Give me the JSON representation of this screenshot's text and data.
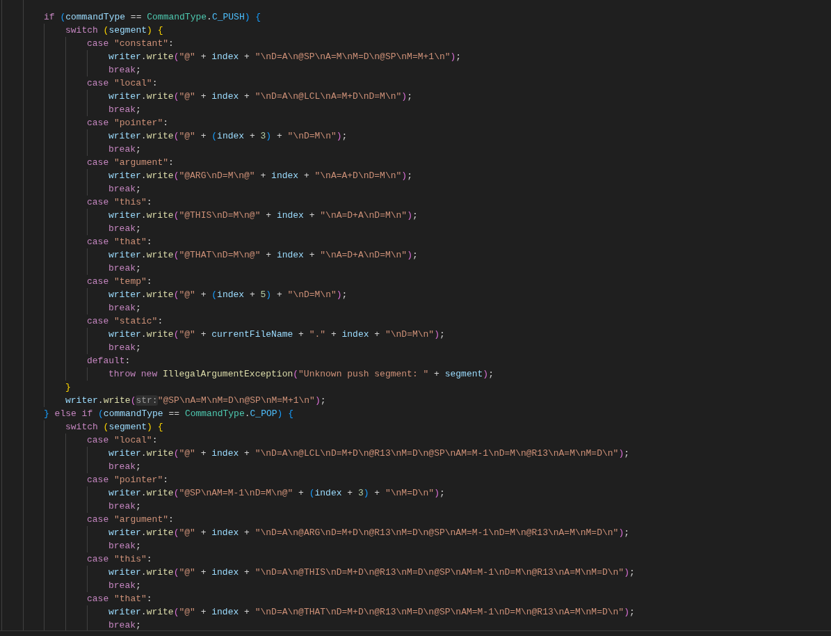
{
  "editor": {
    "lines": [
      {
        "tokens": [
          {
            "kind": "keyword",
            "text": "if "
          },
          {
            "kind": "bracket3",
            "text": "("
          },
          {
            "kind": "variable",
            "text": "commandType"
          },
          {
            "kind": "plain",
            "text": " == "
          },
          {
            "kind": "type",
            "text": "CommandType"
          },
          {
            "kind": "plain",
            "text": "."
          },
          {
            "kind": "constant",
            "text": "C_PUSH"
          },
          {
            "kind": "bracket3",
            "text": ") "
          },
          {
            "kind": "bracket3",
            "text": "{"
          }
        ],
        "children": [
          {
            "tokens": [
              {
                "kind": "keyword",
                "text": "switch "
              },
              {
                "kind": "bracket1",
                "text": "("
              },
              {
                "kind": "variable",
                "text": "segment"
              },
              {
                "kind": "bracket1",
                "text": ") "
              },
              {
                "kind": "bracket1",
                "text": "{"
              }
            ],
            "children": [
              {
                "tokens": [
                  {
                    "kind": "keyword",
                    "text": "case "
                  },
                  {
                    "kind": "string",
                    "text": "\"constant\""
                  },
                  {
                    "kind": "plain",
                    "text": ":"
                  }
                ],
                "children": [
                  {
                    "tokens": [
                      {
                        "kind": "variable",
                        "text": "writer"
                      },
                      {
                        "kind": "plain",
                        "text": "."
                      },
                      {
                        "kind": "function",
                        "text": "write"
                      },
                      {
                        "kind": "bracket2",
                        "text": "("
                      },
                      {
                        "kind": "string",
                        "text": "\"@\""
                      },
                      {
                        "kind": "plain",
                        "text": " + "
                      },
                      {
                        "kind": "variable",
                        "text": "index"
                      },
                      {
                        "kind": "plain",
                        "text": " + "
                      },
                      {
                        "kind": "string",
                        "text": "\"\\nD=A\\n@SP\\nA=M\\nM=D\\n@SP\\nM=M+1\\n\""
                      },
                      {
                        "kind": "bracket2",
                        "text": ")"
                      },
                      {
                        "kind": "plain",
                        "text": ";"
                      }
                    ]
                  },
                  {
                    "tokens": [
                      {
                        "kind": "keyword",
                        "text": "break"
                      },
                      {
                        "kind": "plain",
                        "text": ";"
                      }
                    ]
                  }
                ]
              },
              {
                "tokens": [
                  {
                    "kind": "keyword",
                    "text": "case "
                  },
                  {
                    "kind": "string",
                    "text": "\"local\""
                  },
                  {
                    "kind": "plain",
                    "text": ":"
                  }
                ],
                "children": [
                  {
                    "tokens": [
                      {
                        "kind": "variable",
                        "text": "writer"
                      },
                      {
                        "kind": "plain",
                        "text": "."
                      },
                      {
                        "kind": "function",
                        "text": "write"
                      },
                      {
                        "kind": "bracket2",
                        "text": "("
                      },
                      {
                        "kind": "string",
                        "text": "\"@\""
                      },
                      {
                        "kind": "plain",
                        "text": " + "
                      },
                      {
                        "kind": "variable",
                        "text": "index"
                      },
                      {
                        "kind": "plain",
                        "text": " + "
                      },
                      {
                        "kind": "string",
                        "text": "\"\\nD=A\\n@LCL\\nA=M+D\\nD=M\\n\""
                      },
                      {
                        "kind": "bracket2",
                        "text": ")"
                      },
                      {
                        "kind": "plain",
                        "text": ";"
                      }
                    ]
                  },
                  {
                    "tokens": [
                      {
                        "kind": "keyword",
                        "text": "break"
                      },
                      {
                        "kind": "plain",
                        "text": ";"
                      }
                    ]
                  }
                ]
              },
              {
                "tokens": [
                  {
                    "kind": "keyword",
                    "text": "case "
                  },
                  {
                    "kind": "string",
                    "text": "\"pointer\""
                  },
                  {
                    "kind": "plain",
                    "text": ":"
                  }
                ],
                "children": [
                  {
                    "tokens": [
                      {
                        "kind": "variable",
                        "text": "writer"
                      },
                      {
                        "kind": "plain",
                        "text": "."
                      },
                      {
                        "kind": "function",
                        "text": "write"
                      },
                      {
                        "kind": "bracket2",
                        "text": "("
                      },
                      {
                        "kind": "string",
                        "text": "\"@\""
                      },
                      {
                        "kind": "plain",
                        "text": " + "
                      },
                      {
                        "kind": "bracket3",
                        "text": "("
                      },
                      {
                        "kind": "variable",
                        "text": "index"
                      },
                      {
                        "kind": "plain",
                        "text": " + "
                      },
                      {
                        "kind": "number",
                        "text": "3"
                      },
                      {
                        "kind": "bracket3",
                        "text": ")"
                      },
                      {
                        "kind": "plain",
                        "text": " + "
                      },
                      {
                        "kind": "string",
                        "text": "\"\\nD=M\\n\""
                      },
                      {
                        "kind": "bracket2",
                        "text": ")"
                      },
                      {
                        "kind": "plain",
                        "text": ";"
                      }
                    ]
                  },
                  {
                    "tokens": [
                      {
                        "kind": "keyword",
                        "text": "break"
                      },
                      {
                        "kind": "plain",
                        "text": ";"
                      }
                    ]
                  }
                ]
              },
              {
                "tokens": [
                  {
                    "kind": "keyword",
                    "text": "case "
                  },
                  {
                    "kind": "string",
                    "text": "\"argument\""
                  },
                  {
                    "kind": "plain",
                    "text": ":"
                  }
                ],
                "children": [
                  {
                    "tokens": [
                      {
                        "kind": "variable",
                        "text": "writer"
                      },
                      {
                        "kind": "plain",
                        "text": "."
                      },
                      {
                        "kind": "function",
                        "text": "write"
                      },
                      {
                        "kind": "bracket2",
                        "text": "("
                      },
                      {
                        "kind": "string",
                        "text": "\"@ARG\\nD=M\\n@\""
                      },
                      {
                        "kind": "plain",
                        "text": " + "
                      },
                      {
                        "kind": "variable",
                        "text": "index"
                      },
                      {
                        "kind": "plain",
                        "text": " + "
                      },
                      {
                        "kind": "string",
                        "text": "\"\\nA=A+D\\nD=M\\n\""
                      },
                      {
                        "kind": "bracket2",
                        "text": ")"
                      },
                      {
                        "kind": "plain",
                        "text": ";"
                      }
                    ]
                  },
                  {
                    "tokens": [
                      {
                        "kind": "keyword",
                        "text": "break"
                      },
                      {
                        "kind": "plain",
                        "text": ";"
                      }
                    ]
                  }
                ]
              },
              {
                "tokens": [
                  {
                    "kind": "keyword",
                    "text": "case "
                  },
                  {
                    "kind": "string",
                    "text": "\"this\""
                  },
                  {
                    "kind": "plain",
                    "text": ":"
                  }
                ],
                "children": [
                  {
                    "tokens": [
                      {
                        "kind": "variable",
                        "text": "writer"
                      },
                      {
                        "kind": "plain",
                        "text": "."
                      },
                      {
                        "kind": "function",
                        "text": "write"
                      },
                      {
                        "kind": "bracket2",
                        "text": "("
                      },
                      {
                        "kind": "string",
                        "text": "\"@THIS\\nD=M\\n@\""
                      },
                      {
                        "kind": "plain",
                        "text": " + "
                      },
                      {
                        "kind": "variable",
                        "text": "index"
                      },
                      {
                        "kind": "plain",
                        "text": " + "
                      },
                      {
                        "kind": "string",
                        "text": "\"\\nA=D+A\\nD=M\\n\""
                      },
                      {
                        "kind": "bracket2",
                        "text": ")"
                      },
                      {
                        "kind": "plain",
                        "text": ";"
                      }
                    ]
                  },
                  {
                    "tokens": [
                      {
                        "kind": "keyword",
                        "text": "break"
                      },
                      {
                        "kind": "plain",
                        "text": ";"
                      }
                    ]
                  }
                ]
              },
              {
                "tokens": [
                  {
                    "kind": "keyword",
                    "text": "case "
                  },
                  {
                    "kind": "string",
                    "text": "\"that\""
                  },
                  {
                    "kind": "plain",
                    "text": ":"
                  }
                ],
                "children": [
                  {
                    "tokens": [
                      {
                        "kind": "variable",
                        "text": "writer"
                      },
                      {
                        "kind": "plain",
                        "text": "."
                      },
                      {
                        "kind": "function",
                        "text": "write"
                      },
                      {
                        "kind": "bracket2",
                        "text": "("
                      },
                      {
                        "kind": "string",
                        "text": "\"@THAT\\nD=M\\n@\""
                      },
                      {
                        "kind": "plain",
                        "text": " + "
                      },
                      {
                        "kind": "variable",
                        "text": "index"
                      },
                      {
                        "kind": "plain",
                        "text": " + "
                      },
                      {
                        "kind": "string",
                        "text": "\"\\nA=D+A\\nD=M\\n\""
                      },
                      {
                        "kind": "bracket2",
                        "text": ")"
                      },
                      {
                        "kind": "plain",
                        "text": ";"
                      }
                    ]
                  },
                  {
                    "tokens": [
                      {
                        "kind": "keyword",
                        "text": "break"
                      },
                      {
                        "kind": "plain",
                        "text": ";"
                      }
                    ]
                  }
                ]
              },
              {
                "tokens": [
                  {
                    "kind": "keyword",
                    "text": "case "
                  },
                  {
                    "kind": "string",
                    "text": "\"temp\""
                  },
                  {
                    "kind": "plain",
                    "text": ":"
                  }
                ],
                "children": [
                  {
                    "tokens": [
                      {
                        "kind": "variable",
                        "text": "writer"
                      },
                      {
                        "kind": "plain",
                        "text": "."
                      },
                      {
                        "kind": "function",
                        "text": "write"
                      },
                      {
                        "kind": "bracket2",
                        "text": "("
                      },
                      {
                        "kind": "string",
                        "text": "\"@\""
                      },
                      {
                        "kind": "plain",
                        "text": " + "
                      },
                      {
                        "kind": "bracket3",
                        "text": "("
                      },
                      {
                        "kind": "variable",
                        "text": "index"
                      },
                      {
                        "kind": "plain",
                        "text": " + "
                      },
                      {
                        "kind": "number",
                        "text": "5"
                      },
                      {
                        "kind": "bracket3",
                        "text": ")"
                      },
                      {
                        "kind": "plain",
                        "text": " + "
                      },
                      {
                        "kind": "string",
                        "text": "\"\\nD=M\\n\""
                      },
                      {
                        "kind": "bracket2",
                        "text": ")"
                      },
                      {
                        "kind": "plain",
                        "text": ";"
                      }
                    ]
                  },
                  {
                    "tokens": [
                      {
                        "kind": "keyword",
                        "text": "break"
                      },
                      {
                        "kind": "plain",
                        "text": ";"
                      }
                    ]
                  }
                ]
              },
              {
                "tokens": [
                  {
                    "kind": "keyword",
                    "text": "case "
                  },
                  {
                    "kind": "string",
                    "text": "\"static\""
                  },
                  {
                    "kind": "plain",
                    "text": ":"
                  }
                ],
                "children": [
                  {
                    "tokens": [
                      {
                        "kind": "variable",
                        "text": "writer"
                      },
                      {
                        "kind": "plain",
                        "text": "."
                      },
                      {
                        "kind": "function",
                        "text": "write"
                      },
                      {
                        "kind": "bracket2",
                        "text": "("
                      },
                      {
                        "kind": "string",
                        "text": "\"@\""
                      },
                      {
                        "kind": "plain",
                        "text": " + "
                      },
                      {
                        "kind": "variable",
                        "text": "currentFileName"
                      },
                      {
                        "kind": "plain",
                        "text": " + "
                      },
                      {
                        "kind": "string",
                        "text": "\".\""
                      },
                      {
                        "kind": "plain",
                        "text": " + "
                      },
                      {
                        "kind": "variable",
                        "text": "index"
                      },
                      {
                        "kind": "plain",
                        "text": " + "
                      },
                      {
                        "kind": "string",
                        "text": "\"\\nD=M\\n\""
                      },
                      {
                        "kind": "bracket2",
                        "text": ")"
                      },
                      {
                        "kind": "plain",
                        "text": ";"
                      }
                    ]
                  },
                  {
                    "tokens": [
                      {
                        "kind": "keyword",
                        "text": "break"
                      },
                      {
                        "kind": "plain",
                        "text": ";"
                      }
                    ]
                  }
                ]
              },
              {
                "tokens": [
                  {
                    "kind": "keyword",
                    "text": "default"
                  },
                  {
                    "kind": "plain",
                    "text": ":"
                  }
                ],
                "children": [
                  {
                    "tokens": [
                      {
                        "kind": "keyword",
                        "text": "throw new "
                      },
                      {
                        "kind": "function",
                        "text": "IllegalArgumentException"
                      },
                      {
                        "kind": "bracket2",
                        "text": "("
                      },
                      {
                        "kind": "string",
                        "text": "\"Unknown push segment: \""
                      },
                      {
                        "kind": "plain",
                        "text": " + "
                      },
                      {
                        "kind": "variable",
                        "text": "segment"
                      },
                      {
                        "kind": "bracket2",
                        "text": ")"
                      },
                      {
                        "kind": "plain",
                        "text": ";"
                      }
                    ]
                  }
                ]
              }
            ]
          },
          {
            "tokens": [
              {
                "kind": "bracket1",
                "text": "}"
              }
            ]
          },
          {
            "tokens": [
              {
                "kind": "variable",
                "text": "writer"
              },
              {
                "kind": "plain",
                "text": "."
              },
              {
                "kind": "function",
                "text": "write"
              },
              {
                "kind": "bracket2",
                "text": "("
              },
              {
                "kind": "hint",
                "text": "str:"
              },
              {
                "kind": "string",
                "text": "\"@SP\\nA=M\\nM=D\\n@SP\\nM=M+1\\n\""
              },
              {
                "kind": "bracket2",
                "text": ")"
              },
              {
                "kind": "plain",
                "text": ";"
              }
            ]
          }
        ]
      },
      {
        "tokens": [
          {
            "kind": "bracket3",
            "text": "} "
          },
          {
            "kind": "keyword",
            "text": "else if "
          },
          {
            "kind": "bracket3",
            "text": "("
          },
          {
            "kind": "variable",
            "text": "commandType"
          },
          {
            "kind": "plain",
            "text": " == "
          },
          {
            "kind": "type",
            "text": "CommandType"
          },
          {
            "kind": "plain",
            "text": "."
          },
          {
            "kind": "constant",
            "text": "C_POP"
          },
          {
            "kind": "bracket3",
            "text": ") "
          },
          {
            "kind": "bracket3",
            "text": "{"
          }
        ],
        "children": [
          {
            "tokens": [
              {
                "kind": "keyword",
                "text": "switch "
              },
              {
                "kind": "bracket1",
                "text": "("
              },
              {
                "kind": "variable",
                "text": "segment"
              },
              {
                "kind": "bracket1",
                "text": ") "
              },
              {
                "kind": "bracket1",
                "text": "{"
              }
            ],
            "children": [
              {
                "tokens": [
                  {
                    "kind": "keyword",
                    "text": "case "
                  },
                  {
                    "kind": "string",
                    "text": "\"local\""
                  },
                  {
                    "kind": "plain",
                    "text": ":"
                  }
                ],
                "children": [
                  {
                    "tokens": [
                      {
                        "kind": "variable",
                        "text": "writer"
                      },
                      {
                        "kind": "plain",
                        "text": "."
                      },
                      {
                        "kind": "function",
                        "text": "write"
                      },
                      {
                        "kind": "bracket2",
                        "text": "("
                      },
                      {
                        "kind": "string",
                        "text": "\"@\""
                      },
                      {
                        "kind": "plain",
                        "text": " + "
                      },
                      {
                        "kind": "variable",
                        "text": "index"
                      },
                      {
                        "kind": "plain",
                        "text": " + "
                      },
                      {
                        "kind": "string",
                        "text": "\"\\nD=A\\n@LCL\\nD=M+D\\n@R13\\nM=D\\n@SP\\nAM=M-1\\nD=M\\n@R13\\nA=M\\nM=D\\n\""
                      },
                      {
                        "kind": "bracket2",
                        "text": ")"
                      },
                      {
                        "kind": "plain",
                        "text": ";"
                      }
                    ]
                  },
                  {
                    "tokens": [
                      {
                        "kind": "keyword",
                        "text": "break"
                      },
                      {
                        "kind": "plain",
                        "text": ";"
                      }
                    ]
                  }
                ]
              },
              {
                "tokens": [
                  {
                    "kind": "keyword",
                    "text": "case "
                  },
                  {
                    "kind": "string",
                    "text": "\"pointer\""
                  },
                  {
                    "kind": "plain",
                    "text": ":"
                  }
                ],
                "children": [
                  {
                    "tokens": [
                      {
                        "kind": "variable",
                        "text": "writer"
                      },
                      {
                        "kind": "plain",
                        "text": "."
                      },
                      {
                        "kind": "function",
                        "text": "write"
                      },
                      {
                        "kind": "bracket2",
                        "text": "("
                      },
                      {
                        "kind": "string",
                        "text": "\"@SP\\nAM=M-1\\nD=M\\n@\""
                      },
                      {
                        "kind": "plain",
                        "text": " + "
                      },
                      {
                        "kind": "bracket3",
                        "text": "("
                      },
                      {
                        "kind": "variable",
                        "text": "index"
                      },
                      {
                        "kind": "plain",
                        "text": " + "
                      },
                      {
                        "kind": "number",
                        "text": "3"
                      },
                      {
                        "kind": "bracket3",
                        "text": ")"
                      },
                      {
                        "kind": "plain",
                        "text": " + "
                      },
                      {
                        "kind": "string",
                        "text": "\"\\nM=D\\n\""
                      },
                      {
                        "kind": "bracket2",
                        "text": ")"
                      },
                      {
                        "kind": "plain",
                        "text": ";"
                      }
                    ]
                  },
                  {
                    "tokens": [
                      {
                        "kind": "keyword",
                        "text": "break"
                      },
                      {
                        "kind": "plain",
                        "text": ";"
                      }
                    ]
                  }
                ]
              },
              {
                "tokens": [
                  {
                    "kind": "keyword",
                    "text": "case "
                  },
                  {
                    "kind": "string",
                    "text": "\"argument\""
                  },
                  {
                    "kind": "plain",
                    "text": ":"
                  }
                ],
                "children": [
                  {
                    "tokens": [
                      {
                        "kind": "variable",
                        "text": "writer"
                      },
                      {
                        "kind": "plain",
                        "text": "."
                      },
                      {
                        "kind": "function",
                        "text": "write"
                      },
                      {
                        "kind": "bracket2",
                        "text": "("
                      },
                      {
                        "kind": "string",
                        "text": "\"@\""
                      },
                      {
                        "kind": "plain",
                        "text": " + "
                      },
                      {
                        "kind": "variable",
                        "text": "index"
                      },
                      {
                        "kind": "plain",
                        "text": " + "
                      },
                      {
                        "kind": "string",
                        "text": "\"\\nD=A\\n@ARG\\nD=M+D\\n@R13\\nM=D\\n@SP\\nAM=M-1\\nD=M\\n@R13\\nA=M\\nM=D\\n\""
                      },
                      {
                        "kind": "bracket2",
                        "text": ")"
                      },
                      {
                        "kind": "plain",
                        "text": ";"
                      }
                    ]
                  },
                  {
                    "tokens": [
                      {
                        "kind": "keyword",
                        "text": "break"
                      },
                      {
                        "kind": "plain",
                        "text": ";"
                      }
                    ]
                  }
                ]
              },
              {
                "tokens": [
                  {
                    "kind": "keyword",
                    "text": "case "
                  },
                  {
                    "kind": "string",
                    "text": "\"this\""
                  },
                  {
                    "kind": "plain",
                    "text": ":"
                  }
                ],
                "children": [
                  {
                    "tokens": [
                      {
                        "kind": "variable",
                        "text": "writer"
                      },
                      {
                        "kind": "plain",
                        "text": "."
                      },
                      {
                        "kind": "function",
                        "text": "write"
                      },
                      {
                        "kind": "bracket2",
                        "text": "("
                      },
                      {
                        "kind": "string",
                        "text": "\"@\""
                      },
                      {
                        "kind": "plain",
                        "text": " + "
                      },
                      {
                        "kind": "variable",
                        "text": "index"
                      },
                      {
                        "kind": "plain",
                        "text": " + "
                      },
                      {
                        "kind": "string",
                        "text": "\"\\nD=A\\n@THIS\\nD=M+D\\n@R13\\nM=D\\n@SP\\nAM=M-1\\nD=M\\n@R13\\nA=M\\nM=D\\n\""
                      },
                      {
                        "kind": "bracket2",
                        "text": ")"
                      },
                      {
                        "kind": "plain",
                        "text": ";"
                      }
                    ]
                  },
                  {
                    "tokens": [
                      {
                        "kind": "keyword",
                        "text": "break"
                      },
                      {
                        "kind": "plain",
                        "text": ";"
                      }
                    ]
                  }
                ]
              },
              {
                "tokens": [
                  {
                    "kind": "keyword",
                    "text": "case "
                  },
                  {
                    "kind": "string",
                    "text": "\"that\""
                  },
                  {
                    "kind": "plain",
                    "text": ":"
                  }
                ],
                "children": [
                  {
                    "tokens": [
                      {
                        "kind": "variable",
                        "text": "writer"
                      },
                      {
                        "kind": "plain",
                        "text": "."
                      },
                      {
                        "kind": "function",
                        "text": "write"
                      },
                      {
                        "kind": "bracket2",
                        "text": "("
                      },
                      {
                        "kind": "string",
                        "text": "\"@\""
                      },
                      {
                        "kind": "plain",
                        "text": " + "
                      },
                      {
                        "kind": "variable",
                        "text": "index"
                      },
                      {
                        "kind": "plain",
                        "text": " + "
                      },
                      {
                        "kind": "string",
                        "text": "\"\\nD=A\\n@THAT\\nD=M+D\\n@R13\\nM=D\\n@SP\\nAM=M-1\\nD=M\\n@R13\\nA=M\\nM=D\\n\""
                      },
                      {
                        "kind": "bracket2",
                        "text": ")"
                      },
                      {
                        "kind": "plain",
                        "text": ";"
                      }
                    ]
                  },
                  {
                    "tokens": [
                      {
                        "kind": "keyword",
                        "text": "break"
                      },
                      {
                        "kind": "plain",
                        "text": ";"
                      }
                    ]
                  }
                ]
              }
            ]
          }
        ]
      }
    ]
  }
}
